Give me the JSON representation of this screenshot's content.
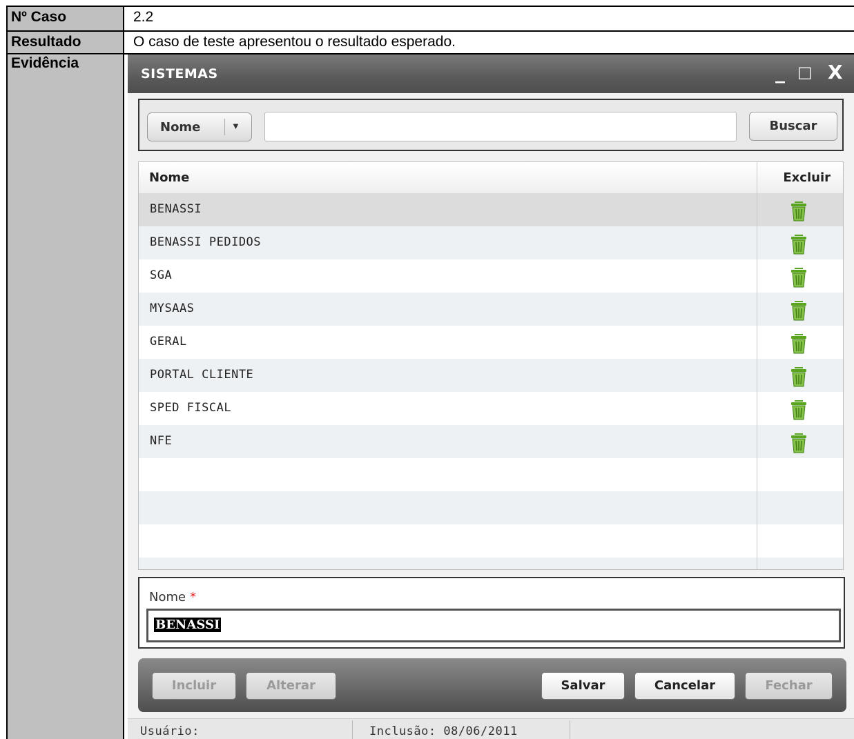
{
  "doc": {
    "rows": [
      {
        "label": "Nº Caso",
        "value": "2.2"
      },
      {
        "label": "Resultado",
        "value": "O caso de teste apresentou o resultado esperado."
      },
      {
        "label": "Evidência",
        "value": ""
      }
    ]
  },
  "window": {
    "title": "SISTEMAS",
    "controls": {
      "minimize": "_",
      "maximize": "☐",
      "close": "X"
    }
  },
  "search": {
    "field_select": "Nome",
    "input_value": "",
    "button": "Buscar"
  },
  "grid": {
    "headers": {
      "name": "Nome",
      "delete": "Excluir"
    },
    "rows": [
      {
        "name": "BENASSI"
      },
      {
        "name": "BENASSI PEDIDOS"
      },
      {
        "name": "SGA"
      },
      {
        "name": "MYSAAS"
      },
      {
        "name": "GERAL"
      },
      {
        "name": "PORTAL CLIENTE"
      },
      {
        "name": "SPED FISCAL"
      },
      {
        "name": "NFE"
      }
    ],
    "selected_index": 0
  },
  "form": {
    "label": "Nome",
    "required_mark": "*",
    "value": "BENASSI"
  },
  "toolbar": {
    "incluir": "Incluir",
    "alterar": "Alterar",
    "salvar": "Salvar",
    "cancelar": "Cancelar",
    "fechar": "Fechar"
  },
  "status": {
    "user": "Usuário:",
    "inclusion": "Inclusão: 08/06/2011"
  },
  "colors": {
    "trash_green": "#5aa51e",
    "label_gray": "#c0c0c0",
    "titlebar": "#5a5a5a"
  }
}
